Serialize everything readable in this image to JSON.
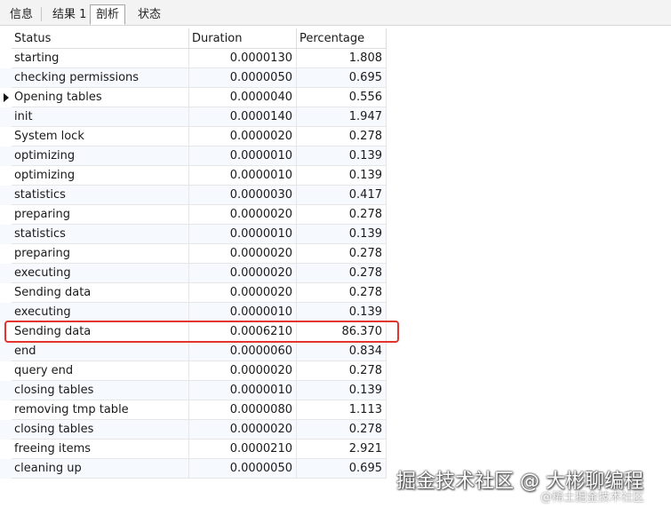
{
  "tabs": [
    {
      "label": "信息"
    },
    {
      "label": "结果 1"
    },
    {
      "label": "剖析"
    },
    {
      "label": "状态"
    }
  ],
  "active_tab": "剖析",
  "columns": [
    "Status",
    "Duration",
    "Percentage"
  ],
  "rows": [
    {
      "status": "starting",
      "duration": "0.0000130",
      "percentage": "1.808"
    },
    {
      "status": "checking permissions",
      "duration": "0.0000050",
      "percentage": "0.695"
    },
    {
      "status": "Opening tables",
      "duration": "0.0000040",
      "percentage": "0.556"
    },
    {
      "status": "init",
      "duration": "0.0000140",
      "percentage": "1.947"
    },
    {
      "status": "System lock",
      "duration": "0.0000020",
      "percentage": "0.278"
    },
    {
      "status": "optimizing",
      "duration": "0.0000010",
      "percentage": "0.139"
    },
    {
      "status": "optimizing",
      "duration": "0.0000010",
      "percentage": "0.139"
    },
    {
      "status": "statistics",
      "duration": "0.0000030",
      "percentage": "0.417"
    },
    {
      "status": "preparing",
      "duration": "0.0000020",
      "percentage": "0.278"
    },
    {
      "status": "statistics",
      "duration": "0.0000010",
      "percentage": "0.139"
    },
    {
      "status": "preparing",
      "duration": "0.0000020",
      "percentage": "0.278"
    },
    {
      "status": "executing",
      "duration": "0.0000020",
      "percentage": "0.278"
    },
    {
      "status": "Sending data",
      "duration": "0.0000020",
      "percentage": "0.278"
    },
    {
      "status": "executing",
      "duration": "0.0000010",
      "percentage": "0.139"
    },
    {
      "status": "Sending data",
      "duration": "0.0006210",
      "percentage": "86.370"
    },
    {
      "status": "end",
      "duration": "0.0000060",
      "percentage": "0.834"
    },
    {
      "status": "query end",
      "duration": "0.0000020",
      "percentage": "0.278"
    },
    {
      "status": "closing tables",
      "duration": "0.0000010",
      "percentage": "0.139"
    },
    {
      "status": "removing tmp table",
      "duration": "0.0000080",
      "percentage": "1.113"
    },
    {
      "status": "closing tables",
      "duration": "0.0000020",
      "percentage": "0.278"
    },
    {
      "status": "freeing items",
      "duration": "0.0000210",
      "percentage": "2.921"
    },
    {
      "status": "cleaning up",
      "duration": "0.0000050",
      "percentage": "0.695"
    }
  ],
  "current_row_status": "Opening tables",
  "highlighted_row_status": "Sending data",
  "colors": {
    "highlight": "#e3342f",
    "alt_row": "#f6fafe"
  },
  "watermark": {
    "main": "掘金技术社区 @ 大彬聊编程",
    "sub": "@稀土掘金技术社区"
  }
}
